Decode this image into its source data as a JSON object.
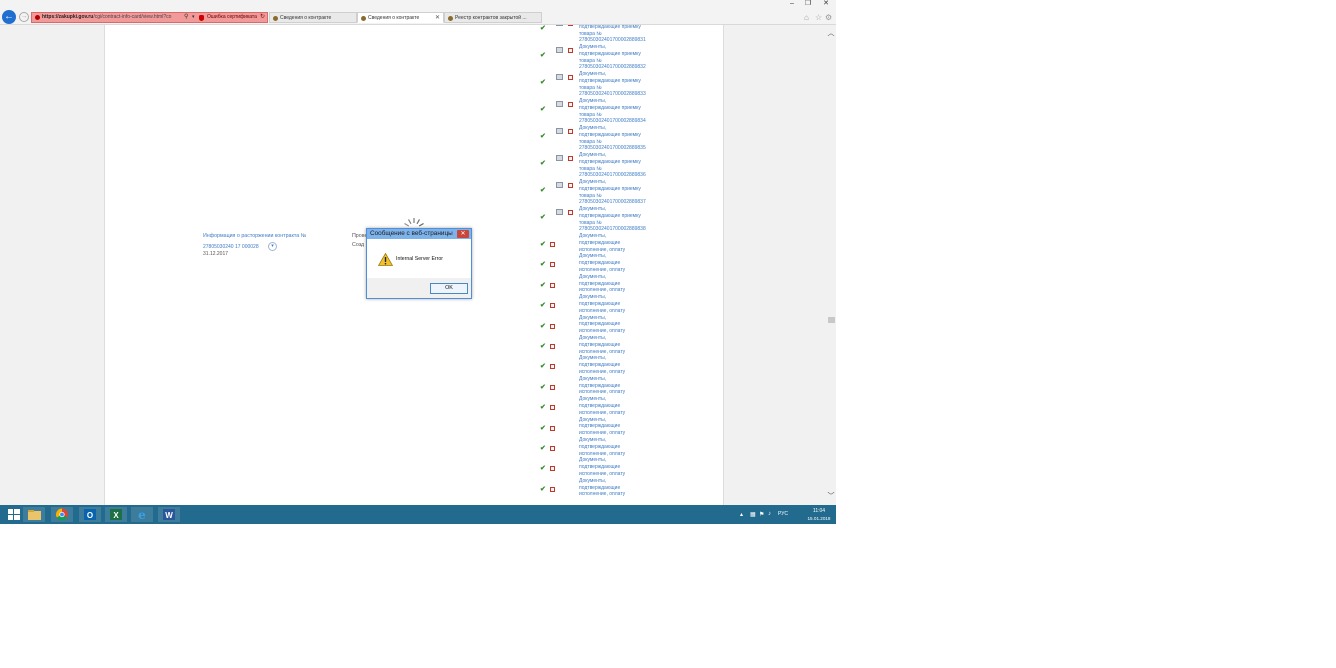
{
  "window": {
    "minimize": "–",
    "restore": "❐",
    "close": "✕"
  },
  "nav": {
    "back": "←",
    "forward": "→"
  },
  "address": {
    "host": "https://zakupki.gov.ru",
    "path": "/cgi/contract-info-card/view.html?co",
    "search": "⚲",
    "dropdown": "▾",
    "cert_error": "Ошибка сертификата",
    "reload": "↻"
  },
  "tabs": [
    {
      "label": "Сведения о контракте",
      "close": ""
    },
    {
      "label": "Сведения о контракте",
      "close": "✕"
    },
    {
      "label": "Реестр контрактов закрытой ...",
      "close": ""
    }
  ],
  "toolbar": {
    "home": "⌂",
    "favorites": "☆",
    "tools": "⚙"
  },
  "acceptance_docs": {
    "line1": "Документы,",
    "line2": "подтверждающие приемку",
    "line3": "товара №",
    "numbers": [
      "278050302401700002889831",
      "278050302401700002889832",
      "278050302401700002889833",
      "278050302401700002889834",
      "278050302401700002889835",
      "278050302401700002889836",
      "278050302401700002889837",
      "278050302401700002889838"
    ]
  },
  "performance_docs": {
    "line1": "Документы,",
    "line2": "подтверждающие",
    "line3": "исполнение, оплату",
    "count": 13
  },
  "termination": {
    "link": "Информация о расторжении контракта №",
    "number": "27805030240 17 000028",
    "date": "31.12.2017"
  },
  "columns": {
    "label1": "Прове",
    "label2": "Созд"
  },
  "dialog": {
    "title": "Сообщение с веб-страницы",
    "close": "✕",
    "message": "Internal Server Error",
    "ok": "OK"
  },
  "scroll": {
    "up": "︿",
    "down": "﹀"
  },
  "taskbar": {
    "excel": "X",
    "outlook": "O",
    "word": "W"
  },
  "tray": {
    "chevron": "▴",
    "lang": "РУС",
    "time": "11:04",
    "date": "15.01.2018"
  }
}
